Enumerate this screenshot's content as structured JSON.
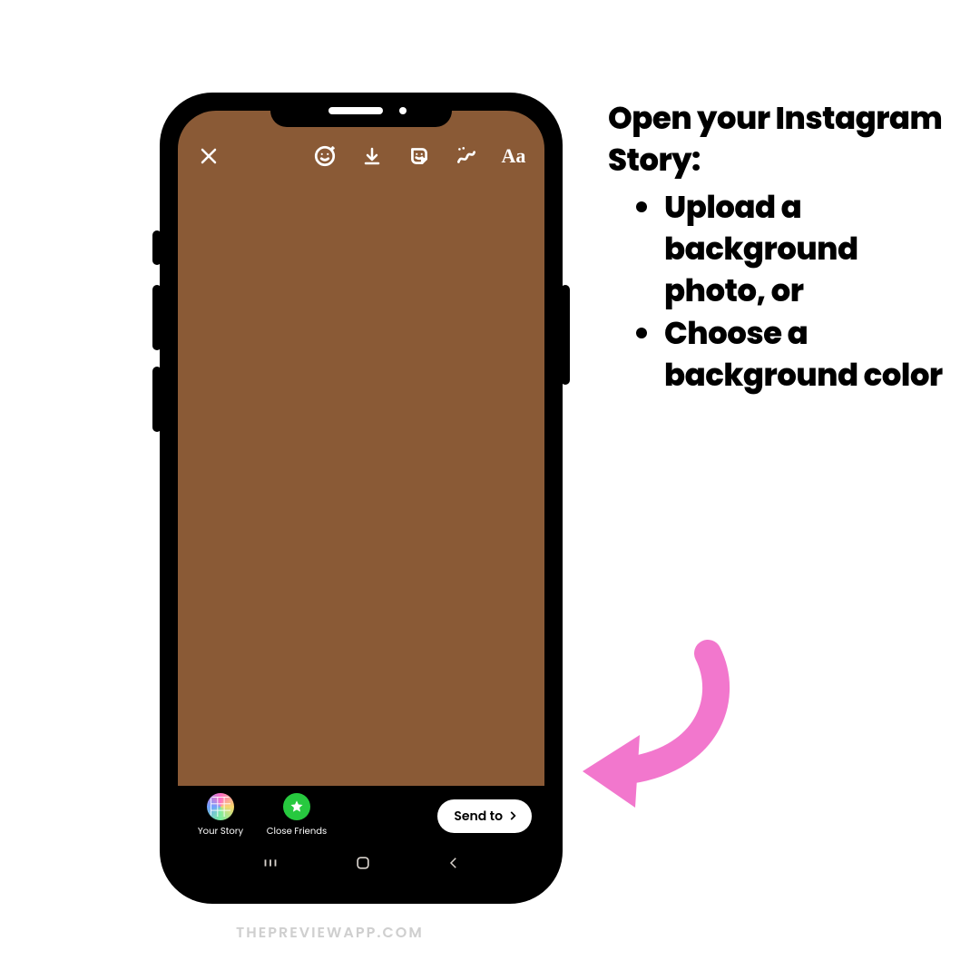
{
  "instructions": {
    "heading": "Open your Instagram Story:",
    "bullets": [
      "Upload a background photo, or",
      "Choose a background color"
    ]
  },
  "story": {
    "background_color": "#8a5a36",
    "toolbar": {
      "text_tool_label": "Aa"
    },
    "share": {
      "your_story_label": "Your Story",
      "close_friends_label": "Close Friends",
      "send_to_label": "Send to"
    }
  },
  "watermark": "THEPREVIEWAPP.COM",
  "arrow_color": "#f277cd"
}
